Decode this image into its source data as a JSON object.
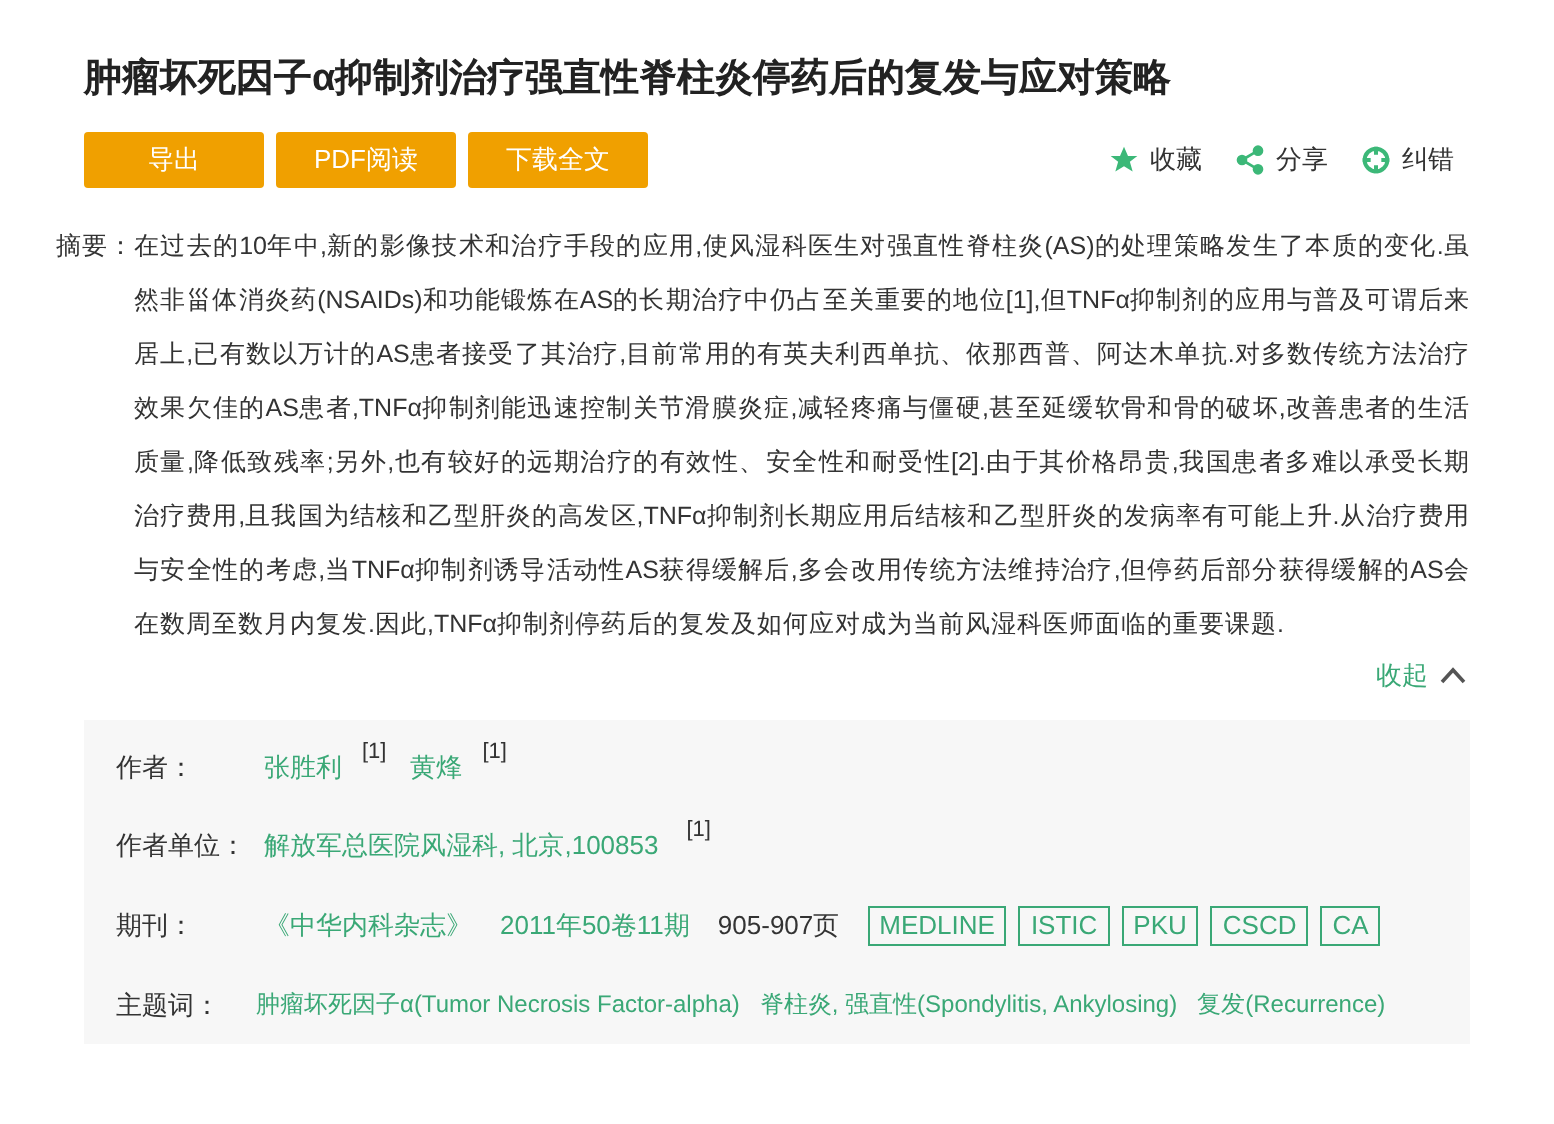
{
  "title": "肿瘤坏死因子α抑制剂治疗强直性脊柱炎停药后的复发与应对策略",
  "buttons": [
    "导出",
    "PDF阅读",
    "下载全文"
  ],
  "actions": [
    {
      "kind": "star",
      "label": "收藏"
    },
    {
      "kind": "share",
      "label": "分享"
    },
    {
      "kind": "correct",
      "label": "纠错"
    }
  ],
  "abstract": {
    "label": "摘要：",
    "text": "在过去的10年中,新的影像技术和治疗手段的应用,使风湿科医生对强直性脊柱炎(AS)的处理策略发生了本质的变化.虽然非甾体消炎药(NSAIDs)和功能锻炼在AS的长期治疗中仍占至关重要的地位[1],但TNFα抑制剂的应用与普及可谓后来居上,已有数以万计的AS患者接受了其治疗,目前常用的有英夫利西单抗、依那西普、阿达木单抗.对多数传统方法治疗效果欠佳的AS患者,TNFα抑制剂能迅速控制关节滑膜炎症,减轻疼痛与僵硬,甚至延缓软骨和骨的破坏,改善患者的生活质量,降低致残率;另外,也有较好的远期治疗的有效性、安全性和耐受性[2].由于其价格昂贵,我国患者多难以承受长期治疗费用,且我国为结核和乙型肝炎的高发区,TNFα抑制剂长期应用后结核和乙型肝炎的发病率有可能上升.从治疗费用与安全性的考虑,当TNFα抑制剂诱导活动性AS获得缓解后,多会改用传统方法维持治疗,但停药后部分获得缓解的AS会在数周至数月内复发.因此,TNFα抑制剂停药后的复发及如何应对成为当前风湿科医师面临的重要课题.",
    "collapse": "收起"
  },
  "info": {
    "authors": {
      "label": "作者：",
      "items": [
        {
          "name": "张胜利",
          "ref": "[1]"
        },
        {
          "name": "黄烽",
          "ref": "[1]"
        }
      ]
    },
    "affiliation": {
      "label": "作者单位：",
      "name": "解放军总医院风湿科, 北京,100853",
      "ref": "[1]"
    },
    "journal": {
      "label": "期刊：",
      "name": "《中华内科杂志》",
      "issue": "2011年50卷11期",
      "pages": "905-907页",
      "tags": [
        "MEDLINE",
        "ISTIC",
        "PKU",
        "CSCD",
        "CA"
      ]
    },
    "keywords": {
      "label": "主题词：",
      "items": [
        "肿瘤坏死因子α(Tumor Necrosis Factor-alpha)",
        "脊柱炎, 强直性(Spondylitis, Ankylosing)",
        "复发(Recurrence)"
      ]
    }
  }
}
